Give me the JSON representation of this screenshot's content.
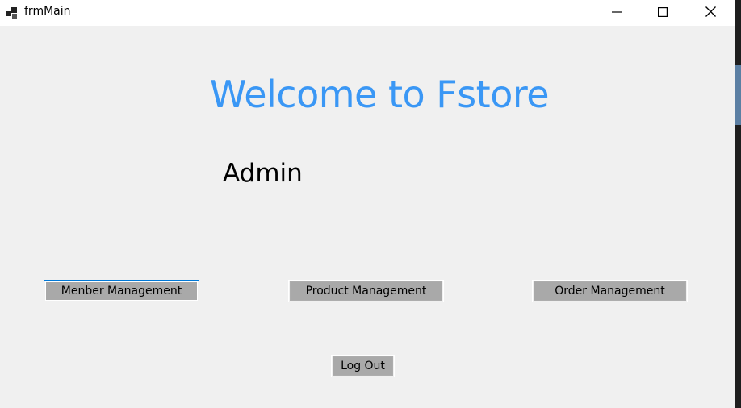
{
  "window": {
    "title": "frmMain",
    "controls": {
      "minimize": "minimize-icon",
      "maximize": "maximize-icon",
      "close": "close-icon"
    }
  },
  "main": {
    "welcome": "Welcome to Fstore",
    "role": "Admin"
  },
  "buttons": {
    "member": "Menber Management",
    "product": "Product Management",
    "order": "Order Management",
    "logout": "Log Out"
  },
  "colors": {
    "accent": "#3a97f5",
    "background": "#f0f0f0",
    "button": "#a9a9a9",
    "focus": "#0078d7"
  }
}
